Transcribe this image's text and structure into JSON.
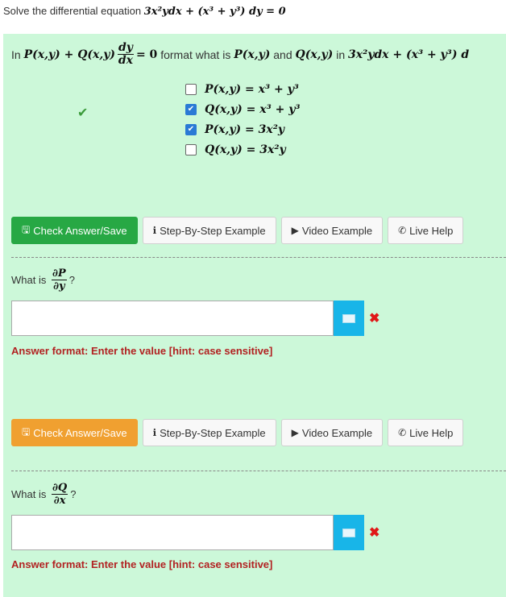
{
  "title": {
    "lead": "Solve the differential equation",
    "equation": "3x²ydx + (x³ + y³) dy = 0"
  },
  "question1": {
    "prefix": "In",
    "pq": "P(x,y) + Q(x,y)",
    "frac_num": "dy",
    "frac_den": "dx",
    "eq_zero": "= 0",
    "middle": "format what is",
    "p": "P(x,y)",
    "and": "and",
    "q": "Q(x,y)",
    "in": "in",
    "equation": "3x²ydx + (x³ + y³) d",
    "options": [
      {
        "label": "P(x,y) = x³ + y³",
        "checked": false
      },
      {
        "label": "Q(x,y) = x³ + y³",
        "checked": true
      },
      {
        "label": "P(x,y) = 3x²y",
        "checked": true
      },
      {
        "label": "Q(x,y) = 3x²y",
        "checked": false
      }
    ]
  },
  "buttons": {
    "check": "Check Answer/Save",
    "step": "Step-By-Step Example",
    "video": "Video Example",
    "help": "Live Help"
  },
  "question2": {
    "what": "What is",
    "num": "∂P",
    "den": "∂y",
    "suffix": "?",
    "value": "",
    "answer_format": "Answer format: Enter the value [hint: case sensitive]"
  },
  "question3": {
    "what": "What is",
    "num": "∂Q",
    "den": "∂x",
    "suffix": "?",
    "value": "",
    "answer_format": "Answer format: Enter the value [hint: case sensitive]"
  },
  "colors": {
    "panel": "#ccf8d9",
    "save_green": "#27a844",
    "save_orange": "#f0a030",
    "keyboard": "#18b5e8",
    "error": "#e01818"
  }
}
